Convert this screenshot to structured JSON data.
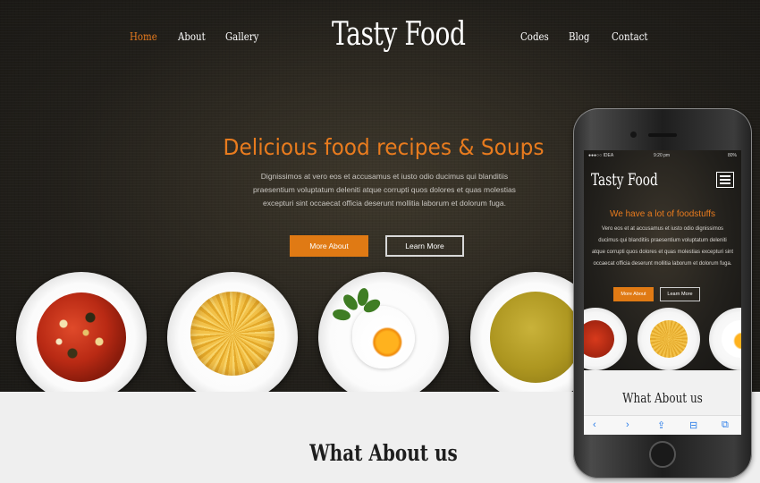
{
  "nav": {
    "left": [
      "Home",
      "About",
      "Gallery"
    ],
    "right": [
      "Codes",
      "Blog",
      "Contact"
    ],
    "active": "Home"
  },
  "logo": "Tasty Food",
  "hero": {
    "title": "Delicious food recipes & Soups",
    "text": "Dignissimos at vero eos et accusamus et iusto odio ducimus qui blanditiis praesentium voluptatum deleniti atque corrupti quos dolores et quas molestias excepturi sint occaecat officia deserunt mollitia laborum et dolorum fuga.",
    "primary_button": "More About",
    "secondary_button": "Learn More"
  },
  "plates": [
    "soup-plate",
    "pasta-plate",
    "egg-plate",
    "yellow-soup-plate"
  ],
  "about_title": "What About us",
  "phone": {
    "status": {
      "carrier": "●●●○○ IDEA",
      "time": "9:20 pm",
      "battery": "80%"
    },
    "logo": "Tasty Food",
    "title": "We have a lot of foodstuffs",
    "text": "Vero eos et at accusamus et iusto odio dignissimos ducimus qui blanditiis praesentium voluptatum deleniti atque corrupti quos dolores et quas molestias excepturi sint occaecat officia deserunt mollitia laborum et dolorum fuga.",
    "primary_button": "More About",
    "secondary_button": "Learn More",
    "about_title": "What About us",
    "toolbar": {
      "back": "‹",
      "forward": "›",
      "share": "⇪",
      "bookmarks": "⊟",
      "tabs": "⧉"
    }
  },
  "colors": {
    "accent": "#e87b1e",
    "hero_bg": "#1d1b17",
    "section_bg": "#efefef"
  }
}
